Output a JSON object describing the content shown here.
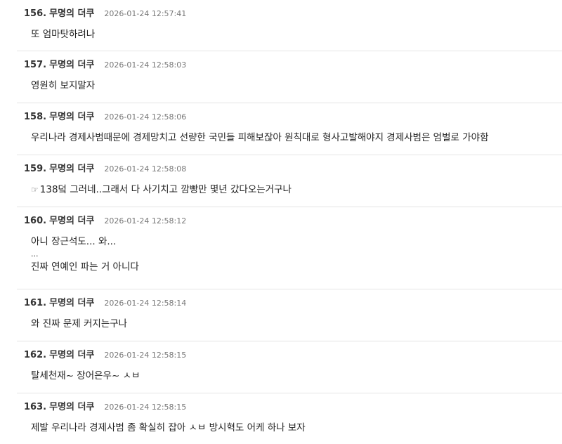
{
  "comments": [
    {
      "no": "156.",
      "author": "무명의 더쿠",
      "time": "2026-01-24 12:57:41",
      "lines": [
        "또 엄마탓하려나"
      ]
    },
    {
      "no": "157.",
      "author": "무명의 더쿠",
      "time": "2026-01-24 12:58:03",
      "lines": [
        "영원히 보지말자"
      ]
    },
    {
      "no": "158.",
      "author": "무명의 더쿠",
      "time": "2026-01-24 12:58:06",
      "lines": [
        "우리나라 경제사범때문에 경제망치고 선량한 국민들 피해보잖아 원칙대로 형사고발해야지 경제사범은 엄벌로 가야함"
      ]
    },
    {
      "no": "159.",
      "author": "무명의 더쿠",
      "time": "2026-01-24 12:58:08",
      "icon": "pointing-hand-icon",
      "lines": [
        "138덬 그러네..그래서 다 사기치고 깜빵만 몇년 갔다오는거구나"
      ]
    },
    {
      "no": "160.",
      "author": "무명의 더쿠",
      "time": "2026-01-24 12:58:12",
      "lines": [
        "아니 장근석도... 와...",
        "...",
        "진짜 연예인 파는 거 아니다"
      ]
    },
    {
      "no": "161.",
      "author": "무명의 더쿠",
      "time": "2026-01-24 12:58:14",
      "lines": [
        "와 진짜 문제 커지는구나"
      ]
    },
    {
      "no": "162.",
      "author": "무명의 더쿠",
      "time": "2026-01-24 12:58:15",
      "lines": [
        "탈세천재~ 장어은우~ ㅅㅂ"
      ]
    },
    {
      "no": "163.",
      "author": "무명의 더쿠",
      "time": "2026-01-24 12:58:15",
      "lines": [
        "제발 우리나라 경제사범 좀 확실히 잡아 ㅅㅂ 방시혁도 어케 하나 보자"
      ]
    }
  ]
}
